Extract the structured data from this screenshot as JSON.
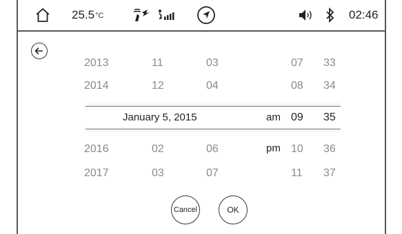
{
  "status_bar": {
    "temperature": "25.5",
    "temperature_unit": "°C",
    "time": "02:46",
    "icons": [
      "home-icon",
      "fan-icon",
      "signal-icon",
      "navigation-icon",
      "volume-icon",
      "bluetooth-icon"
    ]
  },
  "picker": {
    "years_above": [
      "2013",
      "2014"
    ],
    "months_above": [
      "11",
      "12"
    ],
    "days_above": [
      "03",
      "04"
    ],
    "hours_above": [
      "07",
      "08"
    ],
    "minutes_above": [
      "33",
      "34"
    ],
    "selected_date": "January 5, 2015",
    "selected_ampm": "am",
    "selected_hour": "09",
    "selected_minute": "35",
    "years_below": [
      "2016",
      "2017"
    ],
    "months_below": [
      "02",
      "03"
    ],
    "days_below": [
      "06",
      "07"
    ],
    "ampm_below": [
      "pm",
      ""
    ],
    "hours_below": [
      "10",
      "11"
    ],
    "minutes_below": [
      "36",
      "37"
    ]
  },
  "buttons": {
    "cancel_label": "Cancel",
    "ok_label": "OK"
  }
}
